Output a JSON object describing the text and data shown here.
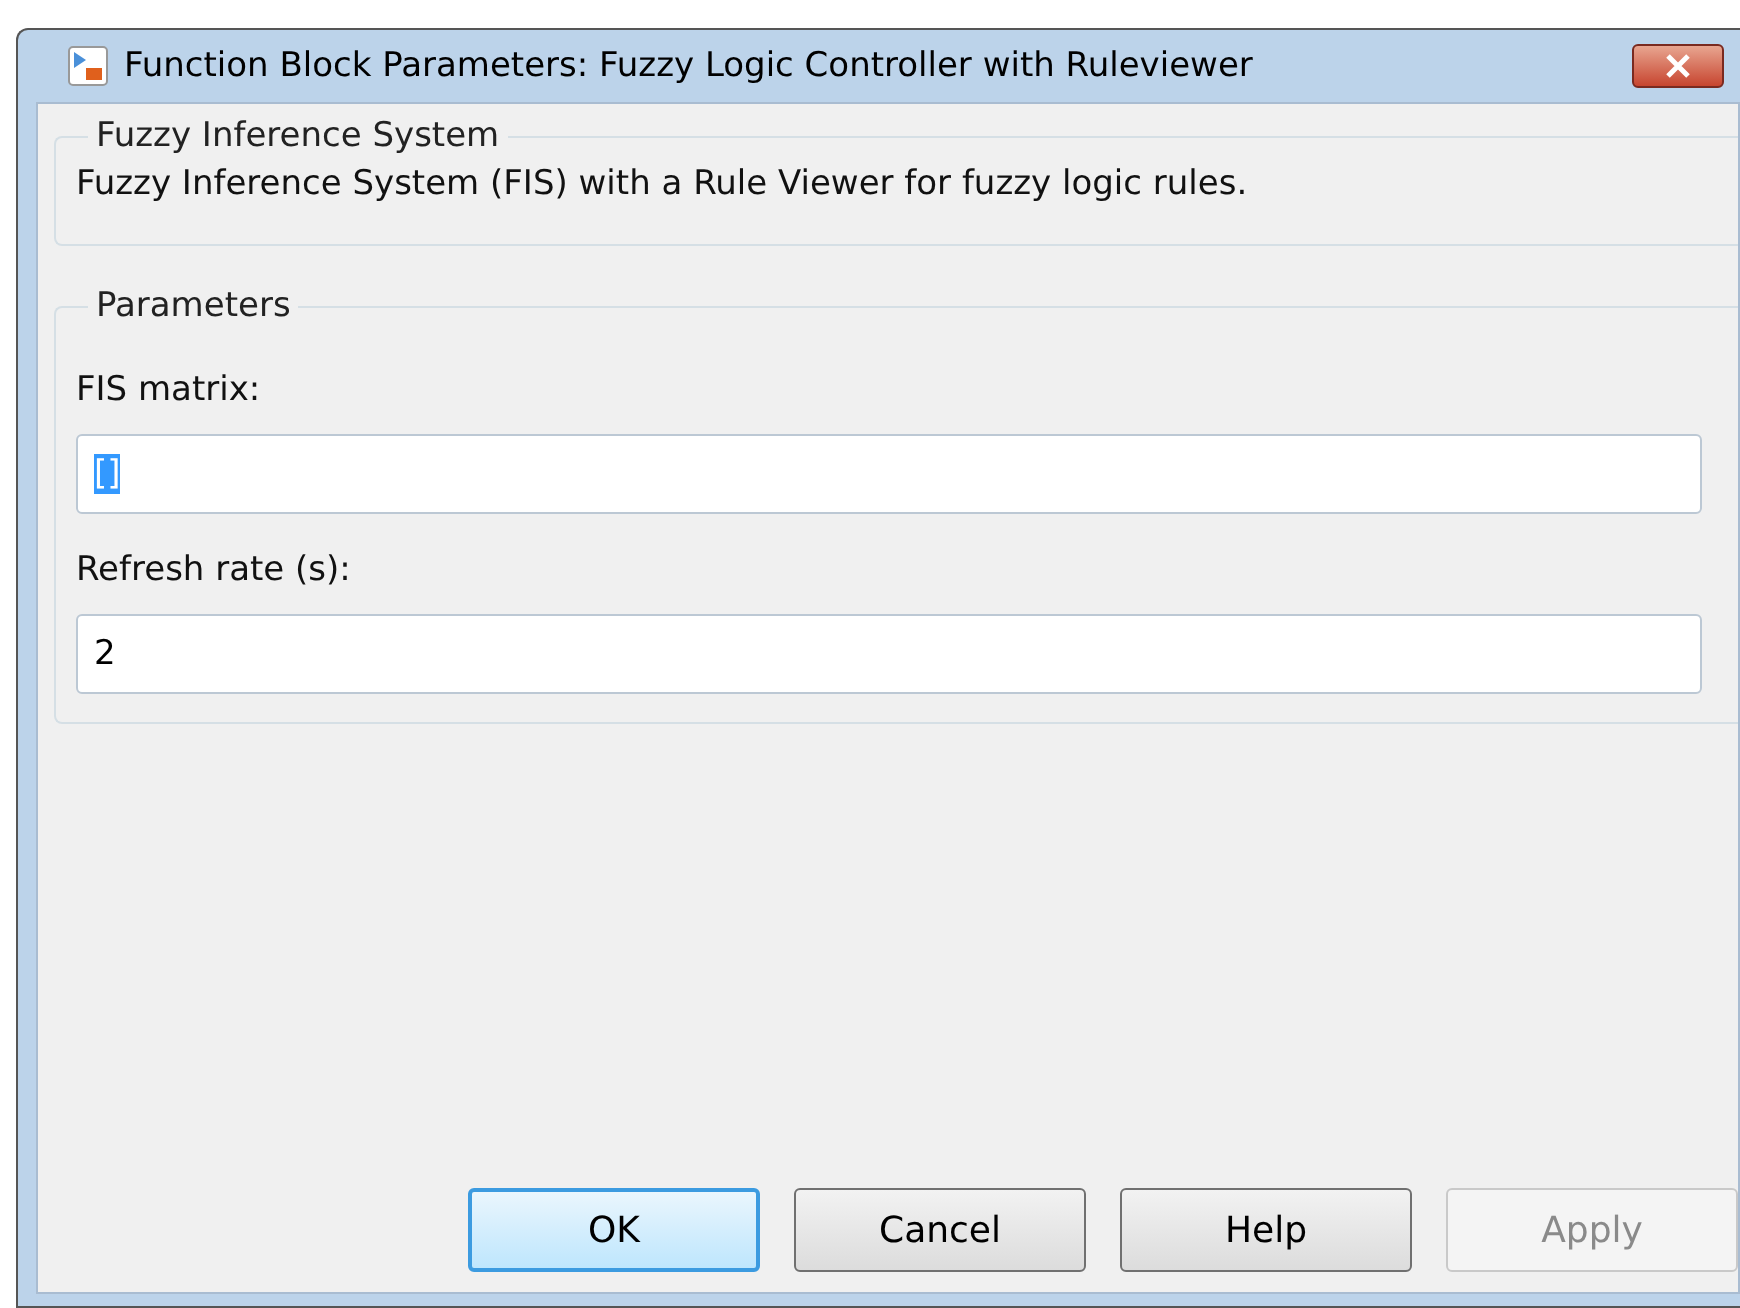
{
  "window": {
    "title": "Function Block Parameters: Fuzzy Logic Controller with Ruleviewer"
  },
  "description_group": {
    "title": "Fuzzy Inference System",
    "text": "Fuzzy Inference System (FIS) with a Rule Viewer for fuzzy logic rules."
  },
  "parameters_group": {
    "title": "Parameters",
    "fields": [
      {
        "label": "FIS matrix:",
        "value": "[]",
        "text_selected": true
      },
      {
        "label": "Refresh rate (s):",
        "value": "2",
        "text_selected": false
      }
    ]
  },
  "buttons": [
    {
      "label": "OK",
      "default": true,
      "disabled": false
    },
    {
      "label": "Cancel",
      "default": false,
      "disabled": false
    },
    {
      "label": "Help",
      "default": false,
      "disabled": false
    },
    {
      "label": "Apply",
      "default": false,
      "disabled": true
    }
  ]
}
